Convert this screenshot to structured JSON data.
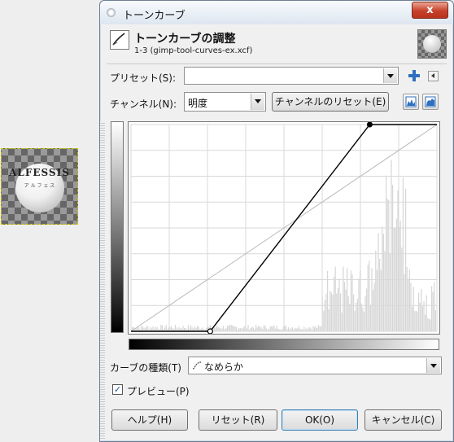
{
  "canvas": {
    "logo_text": "ALFESSIS",
    "logo_subtext": "ア ル フ ェ ス"
  },
  "window": {
    "title": "トーンカーブ",
    "close_label": "x"
  },
  "header": {
    "title": "トーンカーブの調整",
    "subtitle": "1-3 (gimp-tool-curves-ex.xcf)"
  },
  "preset": {
    "label": "プリセット(S):",
    "value": ""
  },
  "channel": {
    "label": "チャンネル(N):",
    "value": "明度",
    "reset_label": "チャンネルのリセット(E)"
  },
  "curve_type": {
    "label": "カーブの種類(T)",
    "value": "なめらか"
  },
  "preview": {
    "label": "プレビュー(P)",
    "checked": true
  },
  "buttons": {
    "help": "ヘルプ(H)",
    "reset": "リセット(R)",
    "ok": "OK(O)",
    "cancel": "キャンセル(C)"
  },
  "curve": {
    "points": [
      [
        0,
        0
      ],
      [
        66,
        0
      ],
      [
        199,
        255
      ],
      [
        255,
        255
      ]
    ],
    "range": [
      0,
      255
    ]
  },
  "colors": {
    "accent_blue": "#2f6fbf",
    "close_red": "#c7402b",
    "histogram": "#d6d6d6",
    "grid": "#d9d9d9"
  }
}
